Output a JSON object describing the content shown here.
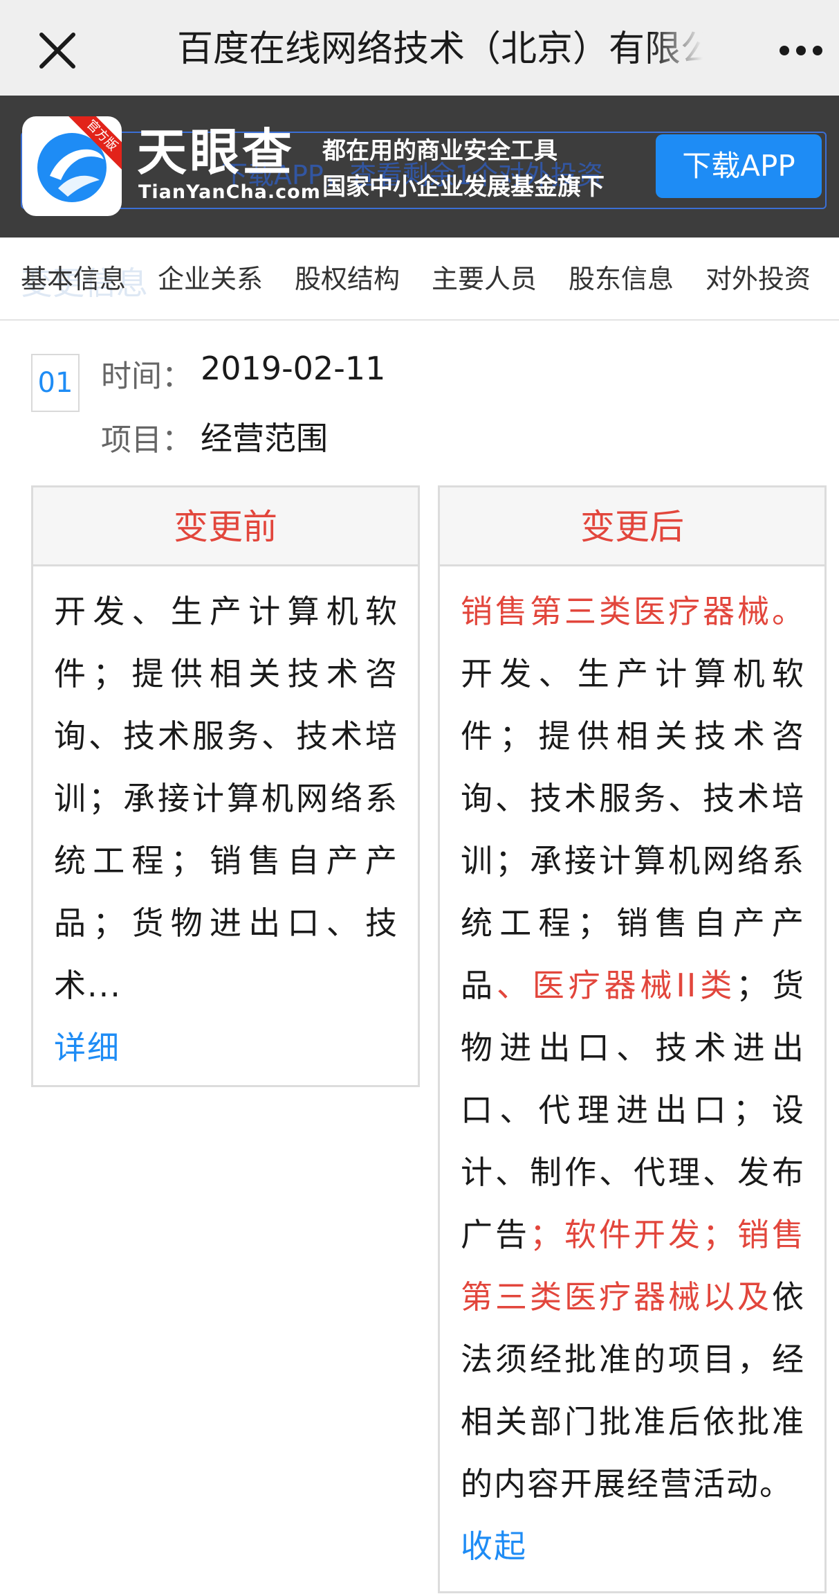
{
  "titlebar": {
    "title": "百度在线网络技术（北京）有限公司",
    "close_icon": "close-icon",
    "more_icon": "more-dots-icon"
  },
  "banner": {
    "brand_name": "天眼查",
    "brand_url": "TianYanCha.com",
    "official_badge": "官方版",
    "slogan_line1": "都在用的商业安全工具",
    "slogan_line2": "国家中小企业发展基金旗下",
    "background_text": "下载APP，查看剩余1个对外投资",
    "download_label": "下载APP",
    "accent": "#1e8cf5"
  },
  "tabs": {
    "ghost_text": "变更信息",
    "items": [
      {
        "label": "基本信息"
      },
      {
        "label": "企业关系"
      },
      {
        "label": "股权结构"
      },
      {
        "label": "主要人员"
      },
      {
        "label": "股东信息"
      },
      {
        "label": "对外投资"
      }
    ]
  },
  "record": {
    "index": "01",
    "time_label": "时间：",
    "time_value": "2019-02-11",
    "item_label": "项目：",
    "item_value": "经营范围"
  },
  "before": {
    "title": "变更前",
    "content": "开发、生产计算机软件；提供相关技术咨询、技术服务、技术培训；承接计算机网络系统工程；销售自产产品；货物进出口、技术...",
    "link_label": "详细"
  },
  "after": {
    "title": "变更后",
    "seg1_hl": "销售第三类医疗器械。",
    "seg2": "开发、生产计算机软件；提供相关技术咨询、技术服务、技术培训；承接计算机网络系统工程；销售自产产品",
    "seg3_hl": "、医疗器械II类",
    "seg4": "；货物进出口、技术进出口、代理进出口；设计、制作、代理、发布广告",
    "seg5_hl": "；软件开发；销售第三类医疗器械以及",
    "seg6": "依法须经批准的项目，经相关部门批准后依批准的内容开展经营活动。",
    "link_label": "收起"
  },
  "colors": {
    "highlight": "#e2463c",
    "link": "#1e8cf5",
    "banner_bg": "#3d3d3d"
  }
}
